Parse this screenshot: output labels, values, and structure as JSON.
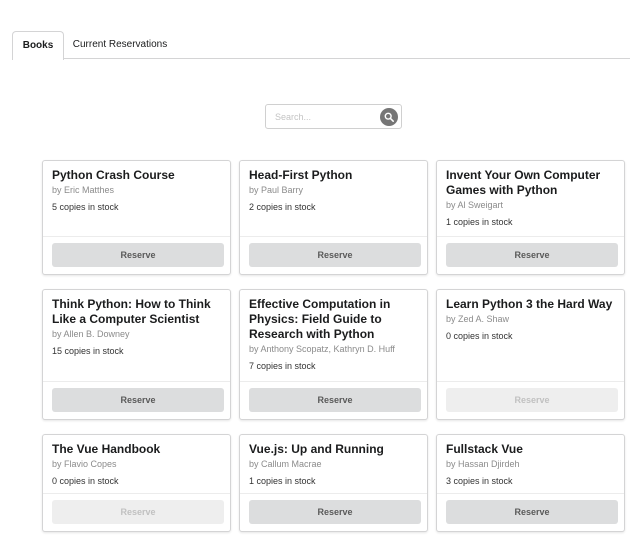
{
  "tabs": [
    {
      "label": "Books",
      "active": true
    },
    {
      "label": "Current Reservations",
      "active": false
    }
  ],
  "search": {
    "placeholder": "Search...",
    "value": ""
  },
  "books": [
    {
      "title": "Python Crash Course",
      "author": "by Eric Matthes",
      "stock": "5 copies in stock",
      "reserve_label": "Reserve",
      "reserve_enabled": true
    },
    {
      "title": "Head-First Python",
      "author": "by Paul Barry",
      "stock": "2 copies in stock",
      "reserve_label": "Reserve",
      "reserve_enabled": true
    },
    {
      "title": "Invent Your Own Computer Games with Python",
      "author": "by Al Sweigart",
      "stock": "1 copies in stock",
      "reserve_label": "Reserve",
      "reserve_enabled": true
    },
    {
      "title": "Think Python: How to Think Like a Computer Scientist",
      "author": "by Allen B. Downey",
      "stock": "15 copies in stock",
      "reserve_label": "Reserve",
      "reserve_enabled": true
    },
    {
      "title": "Effective Computation in Physics: Field Guide to Research with Python",
      "author": "by Anthony Scopatz, Kathryn D. Huff",
      "stock": "7 copies in stock",
      "reserve_label": "Reserve",
      "reserve_enabled": true
    },
    {
      "title": "Learn Python 3 the Hard Way",
      "author": "by Zed A. Shaw",
      "stock": "0 copies in stock",
      "reserve_label": "Reserve",
      "reserve_enabled": false
    },
    {
      "title": "The Vue Handbook",
      "author": "by Flavio Copes",
      "stock": "0 copies in stock",
      "reserve_label": "Reserve",
      "reserve_enabled": false
    },
    {
      "title": "Vue.js: Up and Running",
      "author": "by Callum Macrae",
      "stock": "1 copies in stock",
      "reserve_label": "Reserve",
      "reserve_enabled": true
    },
    {
      "title": "Fullstack Vue",
      "author": "by Hassan Djirdeh",
      "stock": "3 copies in stock",
      "reserve_label": "Reserve",
      "reserve_enabled": true
    }
  ],
  "icons": {
    "search": "search-icon"
  },
  "colors": {
    "button_bg": "#dcddde",
    "button_disabled_bg": "#eeeeee",
    "search_button": "#767676"
  }
}
